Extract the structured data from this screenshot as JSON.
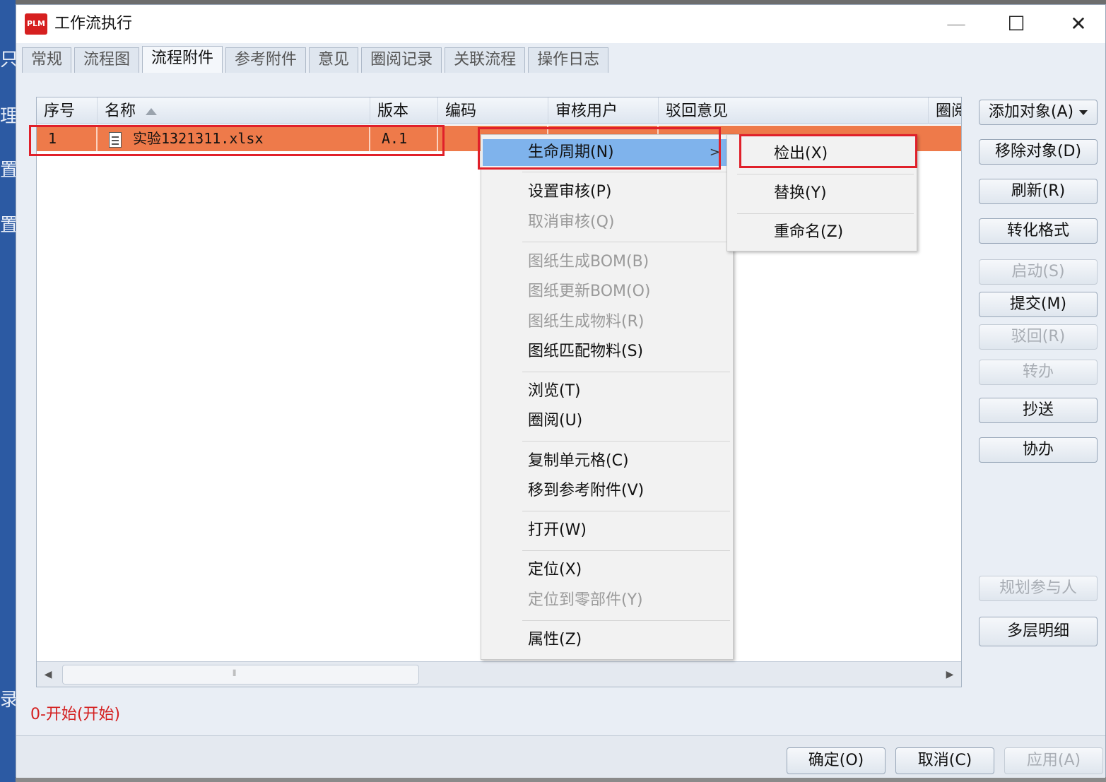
{
  "background": {
    "left_strip_chars": [
      "只",
      "理",
      "置",
      "置",
      "录"
    ]
  },
  "window": {
    "title": "工作流执行",
    "app_icon_text": "PLM",
    "controls": {
      "minimize": "—",
      "maximize": "☐",
      "close": "✕"
    }
  },
  "tabs": [
    {
      "label": "常规"
    },
    {
      "label": "流程图"
    },
    {
      "label": "流程附件",
      "active": true
    },
    {
      "label": "参考附件"
    },
    {
      "label": "意见"
    },
    {
      "label": "圈阅记录"
    },
    {
      "label": "关联流程"
    },
    {
      "label": "操作日志"
    }
  ],
  "grid": {
    "columns": [
      "序号",
      "名称",
      "版本",
      "编码",
      "审核用户",
      "驳回意见",
      "圈阅"
    ],
    "rows": [
      {
        "index": "1",
        "name": "实验1321311.xlsx",
        "version": "A.1",
        "code": "",
        "reviewer": "",
        "reject": ""
      }
    ],
    "scroll_mid": "⦀"
  },
  "status_text": "0-开始(开始)",
  "side_buttons": [
    {
      "label": "添加对象(A)",
      "disabled": false,
      "dropdown": true
    },
    {
      "label": "移除对象(D)",
      "disabled": false
    },
    {
      "label": "刷新(R)",
      "disabled": false
    },
    {
      "label": "转化格式",
      "disabled": false
    },
    {
      "label": "启动(S)",
      "disabled": true
    },
    {
      "label": "提交(M)",
      "disabled": false
    },
    {
      "label": "驳回(R)",
      "disabled": true
    },
    {
      "label": "转办",
      "disabled": true
    },
    {
      "label": "抄送",
      "disabled": false
    },
    {
      "label": "协办",
      "disabled": false
    },
    {
      "label": "规划参与人",
      "disabled": true
    },
    {
      "label": "多层明细",
      "disabled": false
    }
  ],
  "bottom_buttons": [
    {
      "label": "确定(O)",
      "disabled": false
    },
    {
      "label": "取消(C)",
      "disabled": false
    },
    {
      "label": "应用(A)",
      "disabled": true
    }
  ],
  "context_menu": {
    "items": [
      {
        "label": "生命周期(N)",
        "selected": true,
        "submenu": true
      },
      {
        "label": "设置审核(P)"
      },
      {
        "label": "取消审核(Q)",
        "disabled": true
      },
      {
        "label": "图纸生成BOM(B)",
        "disabled": true
      },
      {
        "label": "图纸更新BOM(O)",
        "disabled": true
      },
      {
        "label": "图纸生成物料(R)",
        "disabled": true
      },
      {
        "label": "图纸匹配物料(S)"
      },
      {
        "label": "浏览(T)"
      },
      {
        "label": "圈阅(U)"
      },
      {
        "label": "复制单元格(C)"
      },
      {
        "label": "移到参考附件(V)"
      },
      {
        "label": "打开(W)"
      },
      {
        "label": "定位(X)"
      },
      {
        "label": "定位到零部件(Y)",
        "disabled": true
      },
      {
        "label": "属性(Z)"
      }
    ],
    "submenu_arrow": ">"
  },
  "submenu": {
    "items": [
      {
        "label": "检出(X)"
      },
      {
        "label": "替换(Y)"
      },
      {
        "label": "重命名(Z)"
      }
    ]
  },
  "colors": {
    "selected_row": "#ee7a4a",
    "highlight_box": "#e0202a",
    "menu_selected": "#7fb3ec",
    "status_text": "#d42020"
  }
}
